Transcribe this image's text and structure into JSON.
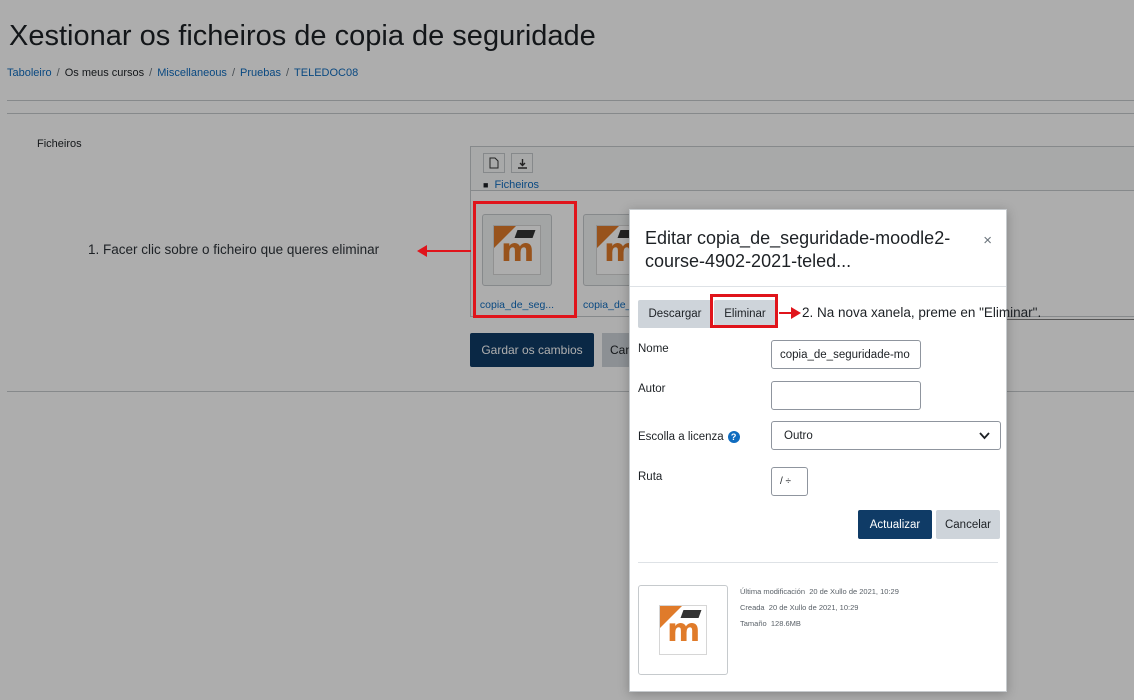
{
  "page": {
    "title": "Xestionar os ficheiros de copia de seguridade",
    "breadcrumb": [
      "Taboleiro",
      "Os meus cursos",
      "Miscellaneous",
      "Pruebas",
      "TELEDOC08"
    ],
    "files_label": "Ficheiros",
    "path_label": "Ficheiros",
    "files": [
      {
        "name": "copia_de_seg...",
        "icon": "moodle-file-icon"
      },
      {
        "name": "copia_de_",
        "icon": "moodle-file-icon"
      }
    ],
    "save_button": "Gardar os cambios",
    "cancel_button": "Cancelar"
  },
  "annotations": {
    "step1": "1. Facer clic sobre o ficheiro que queres eliminar",
    "step2": "2. Na nova xanela, preme en \"Eliminar\"."
  },
  "modal": {
    "title": "Editar copia_de_seguridade-moodle2-course-4902-2021-teled...",
    "close_symbol": "×",
    "download_button": "Descargar",
    "delete_button": "Eliminar",
    "fields": {
      "name_label": "Nome",
      "name_value": "copia_de_seguridade-mo",
      "author_label": "Autor",
      "author_value": "",
      "license_label": "Escolla a licenza",
      "license_value": "Outro",
      "path_label": "Ruta",
      "path_value": "/ ÷"
    },
    "update_button": "Actualizar",
    "cancel_button": "Cancelar",
    "meta": {
      "modified_label": "Última modificación",
      "modified_value": "20 de Xullo de 2021, 10:29",
      "created_label": "Creada",
      "created_value": "20 de Xullo de 2021, 10:29",
      "size_label": "Tamaño",
      "size_value": "128.6MB"
    }
  },
  "colors": {
    "primary": "#0f3b66",
    "link": "#0f6cbf",
    "annotation_red": "#e0141b",
    "moodle_orange": "#e07b2a"
  }
}
